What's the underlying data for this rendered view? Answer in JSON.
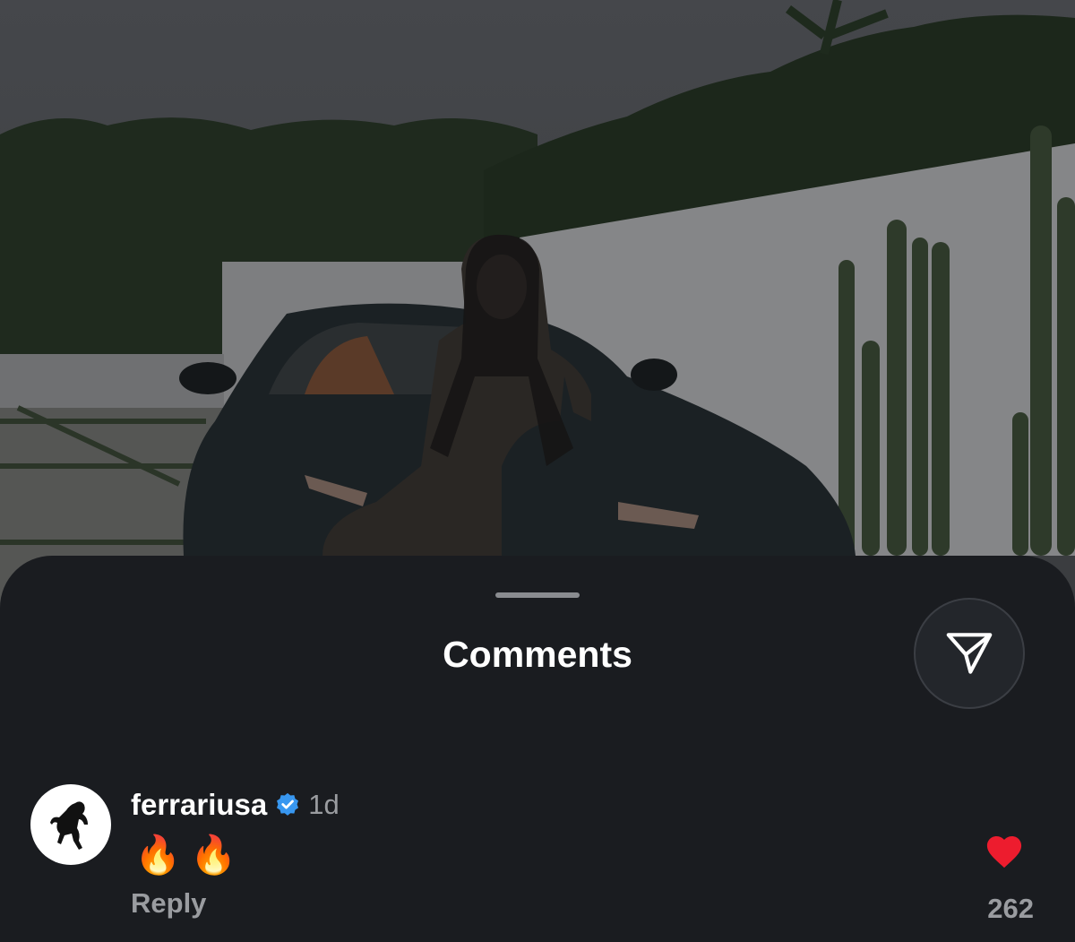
{
  "sheet": {
    "title": "Comments",
    "share_icon": "send-icon"
  },
  "comment": {
    "username": "ferrariusa",
    "verified_icon": "verified-badge-icon",
    "timestamp": "1d",
    "text": "🔥🔥",
    "reply_label": "Reply",
    "like_count": "262",
    "like_icon": "heart-icon",
    "avatar_icon": "prancing-horse-icon"
  },
  "colors": {
    "sheet_bg": "#1a1c20",
    "verified_blue": "#3897f0",
    "heart_red": "#ed1c2e",
    "muted_text": "#9a9ca0"
  }
}
